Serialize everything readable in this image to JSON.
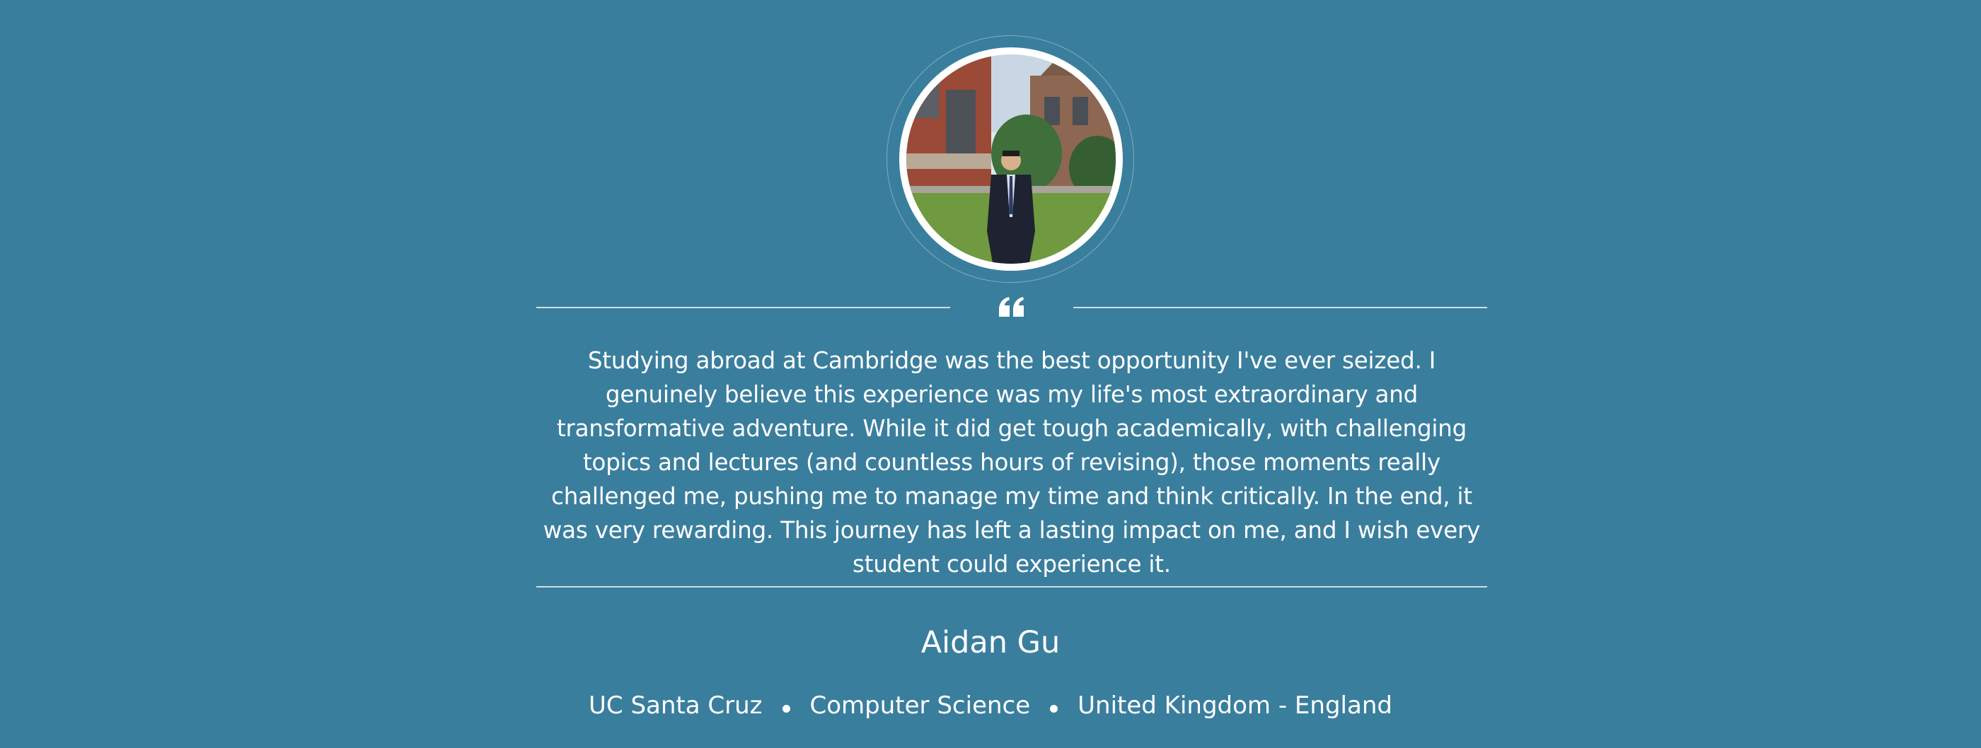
{
  "colors": {
    "background": "#3a7e9d",
    "text": "#ffffff"
  },
  "avatar": {
    "icon": "profile-photo"
  },
  "quote_icon": "quote-left-icon",
  "testimonial": {
    "text": "Studying abroad at Cambridge was the best opportunity I've ever seized. I genuinely believe this experience was my life's most extraordinary and transformative adventure. While it did get tough academically, with challenging topics and lectures (and countless hours of revising), those moments really challenged me, pushing me to manage my time and think critically. In the end, it was very rewarding. This journey has left a lasting impact on me, and I wish every student could experience it."
  },
  "person": {
    "name": "Aidan Gu",
    "university": "UC Santa Cruz",
    "major": "Computer Science",
    "location": "United Kingdom - England"
  }
}
